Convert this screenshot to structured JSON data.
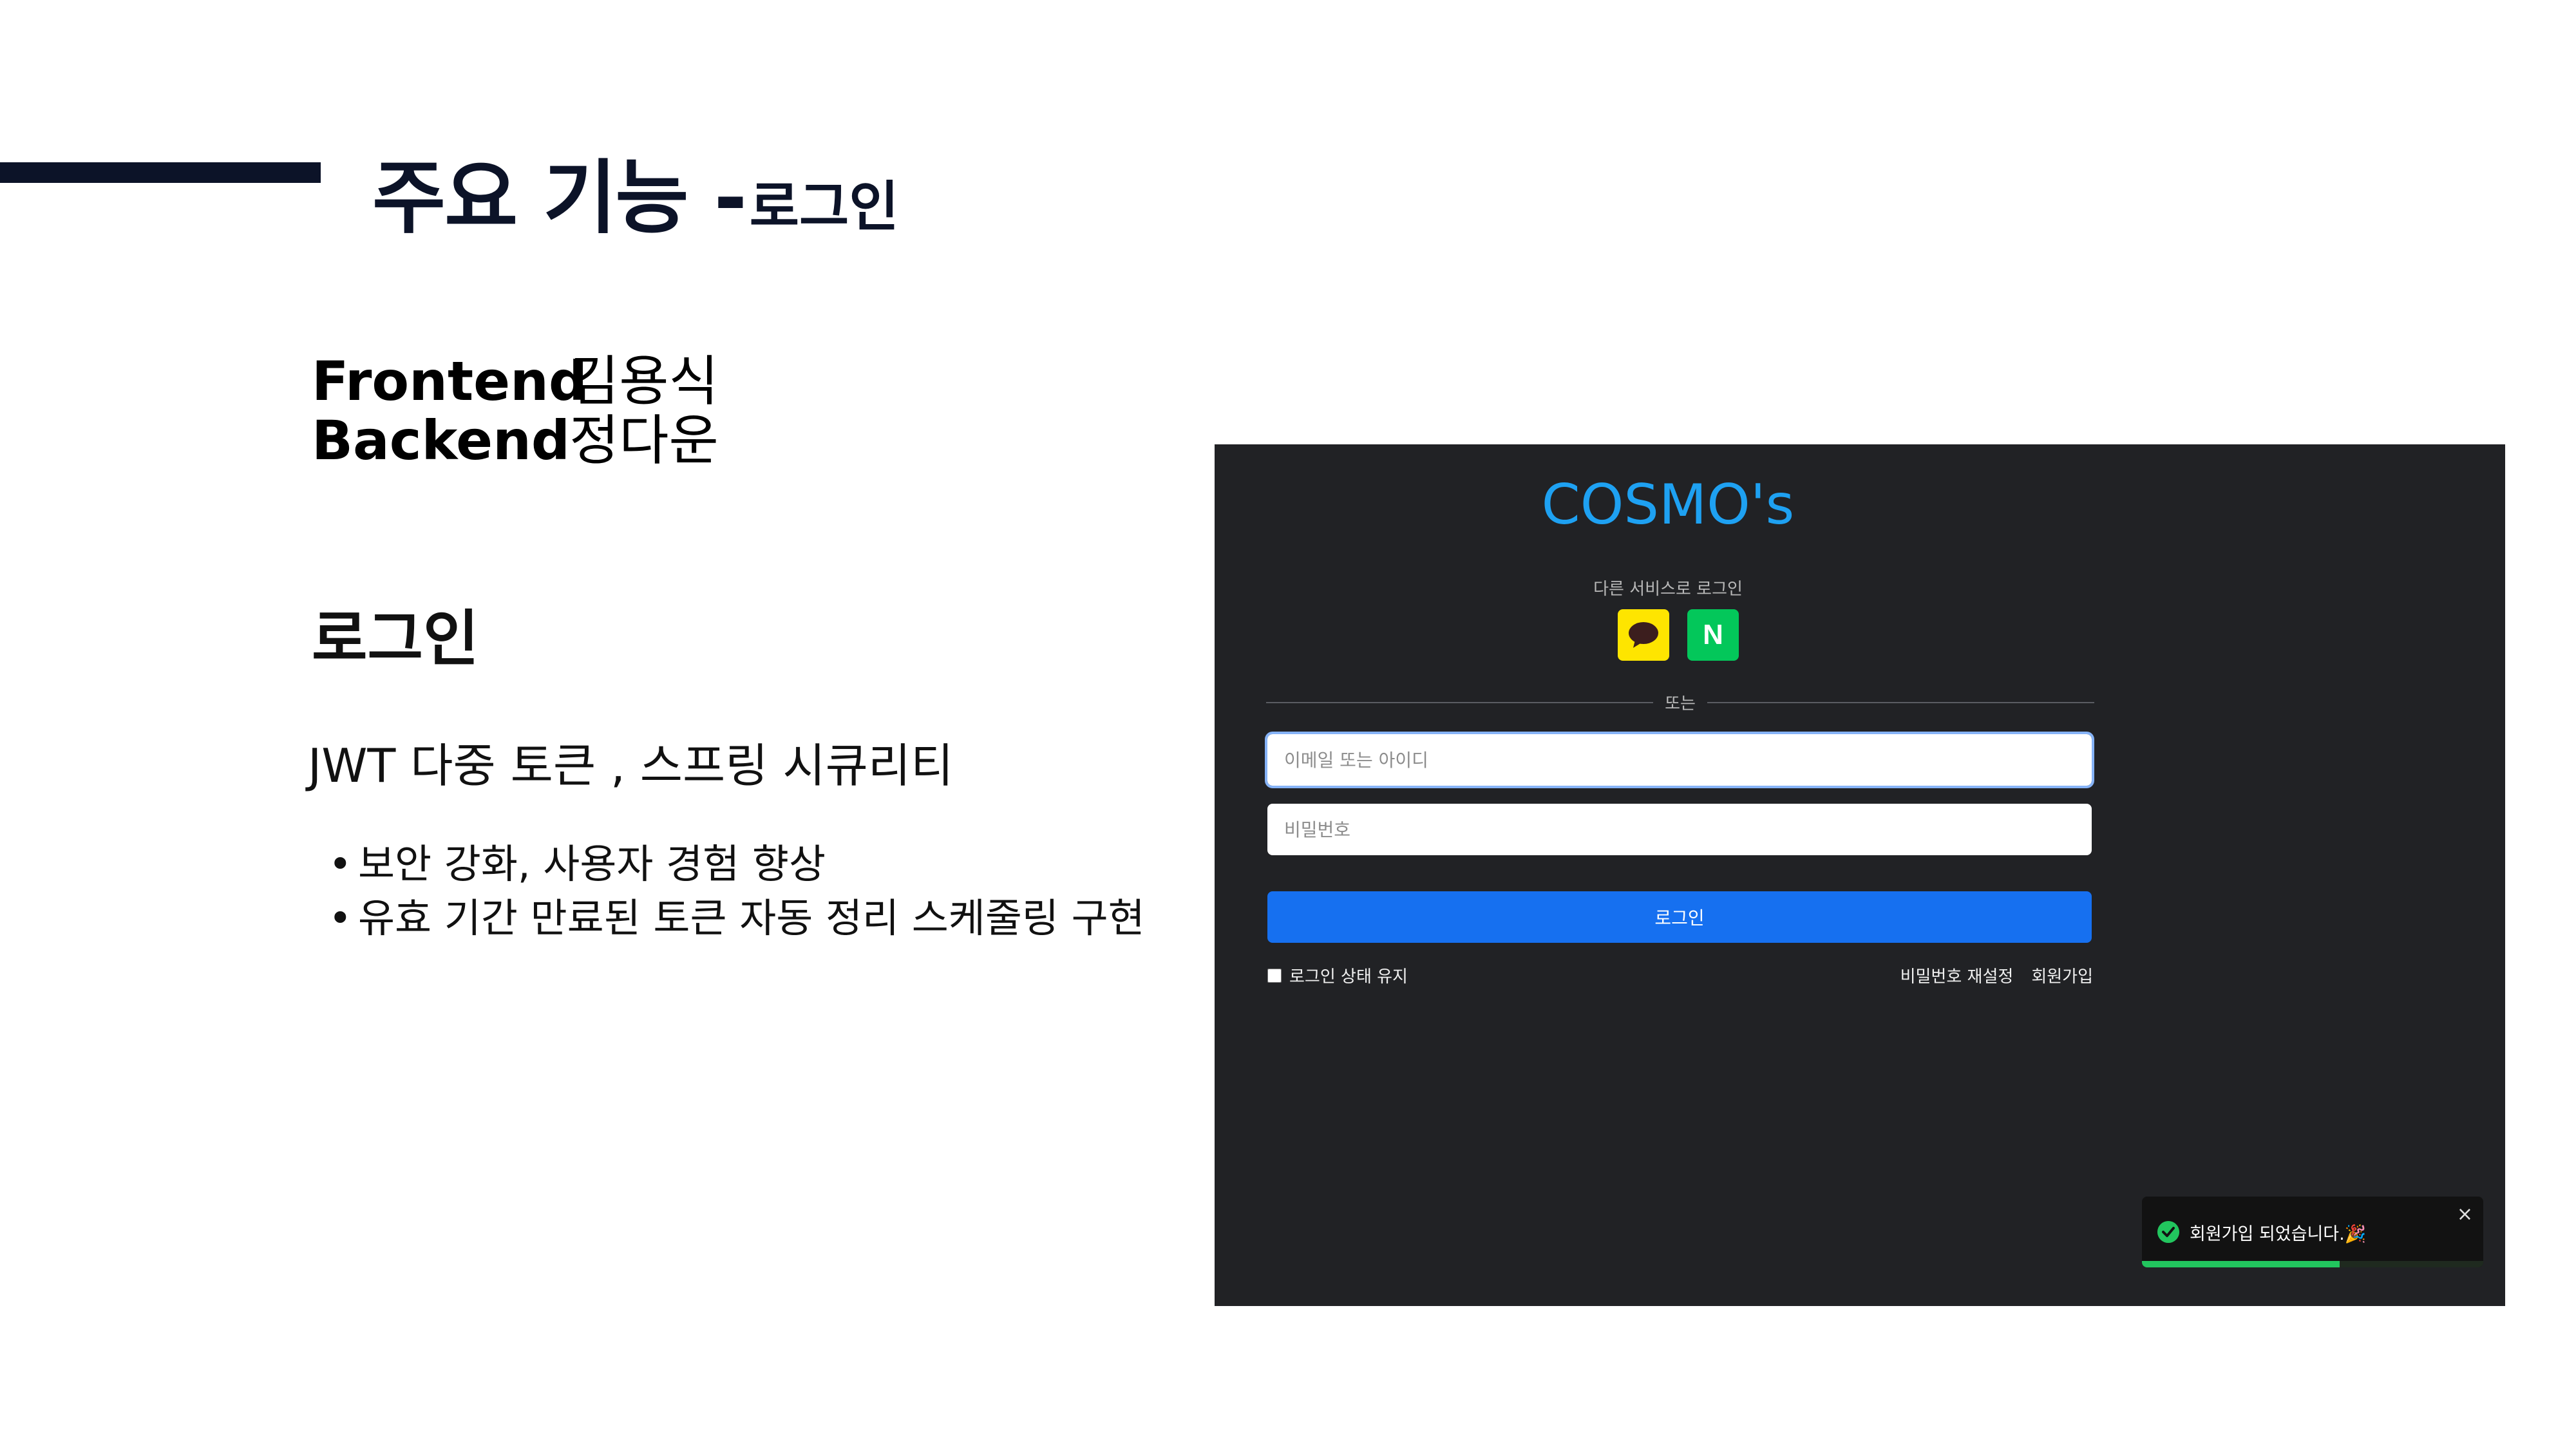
{
  "slide": {
    "title_main": "주요 기능 -",
    "title_sub": "로그인",
    "roles": [
      {
        "label": "Frontend",
        "name": "김용식"
      },
      {
        "label": "Backend",
        "name": "정다운"
      }
    ],
    "section_title": "로그인",
    "summary": "JWT 다중 토큰 , 스프링 시큐리티",
    "bullets": [
      "보안 강화, 사용자 경험 향상",
      "유효 기간 만료된 토큰 자동 정리 스케줄링 구현"
    ],
    "accent_color": "#0c1328"
  },
  "app": {
    "brand": "COSMO's",
    "brand_color": "#1ea1f2",
    "social_label": "다른 서비스로 로그인",
    "social": [
      {
        "name": "kakao",
        "icon": "kakao-speech-bubble-icon",
        "color": "#fee500"
      },
      {
        "name": "naver",
        "icon": "naver-n-icon",
        "label": "N",
        "color": "#03c75a"
      }
    ],
    "divider_text": "또는",
    "id_placeholder": "이메일 또는 아이디",
    "password_placeholder": "비밀번호",
    "login_button": "로그인",
    "login_button_color": "#1670f0",
    "remember_label": "로그인 상태 유지",
    "reset_password_link": "비밀번호 재설정",
    "signup_link": "회원가입",
    "toast": {
      "message": "회원가입 되었습니다.🎉",
      "close_icon": "close-icon",
      "status_icon": "check-circle-icon",
      "progress": 0.58
    }
  }
}
